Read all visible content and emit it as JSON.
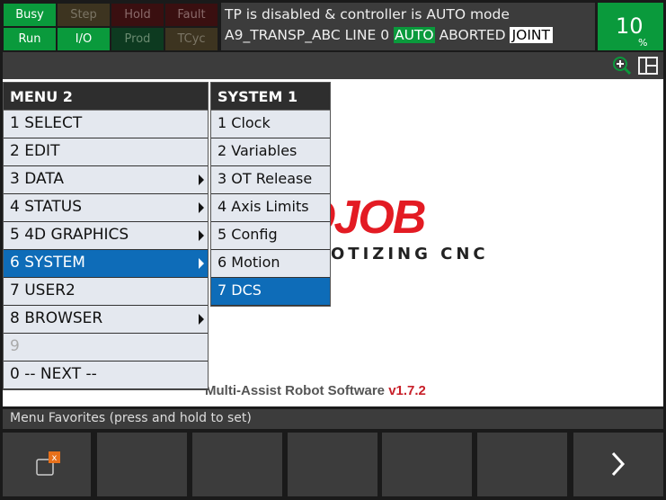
{
  "status": {
    "busy": "Busy",
    "step": "Step",
    "hold": "Hold",
    "fault": "Fault",
    "run": "Run",
    "io": "I/O",
    "prod": "Prod",
    "tcyc": "TCyc"
  },
  "message": {
    "line1": "TP is disabled & controller is AUTO mode",
    "program": "A9_TRANSP_ABC LINE 0",
    "mode": "AUTO",
    "state": "ABORTED",
    "coord": "JOINT"
  },
  "override": {
    "value": "10",
    "unit": "%"
  },
  "toolbar": {
    "icons": [
      "zoom-in-icon",
      "split-screen-icon"
    ]
  },
  "menu": {
    "title": "MENU  2",
    "items": [
      {
        "label": "1 SELECT"
      },
      {
        "label": "2 EDIT"
      },
      {
        "label": "3 DATA"
      },
      {
        "label": "4 STATUS"
      },
      {
        "label": "5 4D GRAPHICS"
      },
      {
        "label": "6 SYSTEM"
      },
      {
        "label": "7 USER2"
      },
      {
        "label": "8 BROWSER"
      },
      {
        "label": "9"
      },
      {
        "label": "0 -- NEXT --"
      }
    ]
  },
  "submenu": {
    "title": "SYSTEM  1",
    "items": [
      {
        "label": "1 Clock"
      },
      {
        "label": "2 Variables"
      },
      {
        "label": "3 OT Release"
      },
      {
        "label": "4 Axis Limits"
      },
      {
        "label": "5 Config"
      },
      {
        "label": "6 Motion"
      },
      {
        "label": "7 DCS"
      }
    ]
  },
  "logo": {
    "brand": "OJOB",
    "tagline": "OTIZING CNC"
  },
  "footer": {
    "software": "Multi-Assist Robot Software",
    "version": "v1.7.2"
  },
  "favorites": {
    "label": "Menu Favorites (press and hold to set)"
  },
  "colors": {
    "green": "#0a9a3c",
    "selection": "#0e6cb8",
    "brand_red": "#e31b23"
  }
}
